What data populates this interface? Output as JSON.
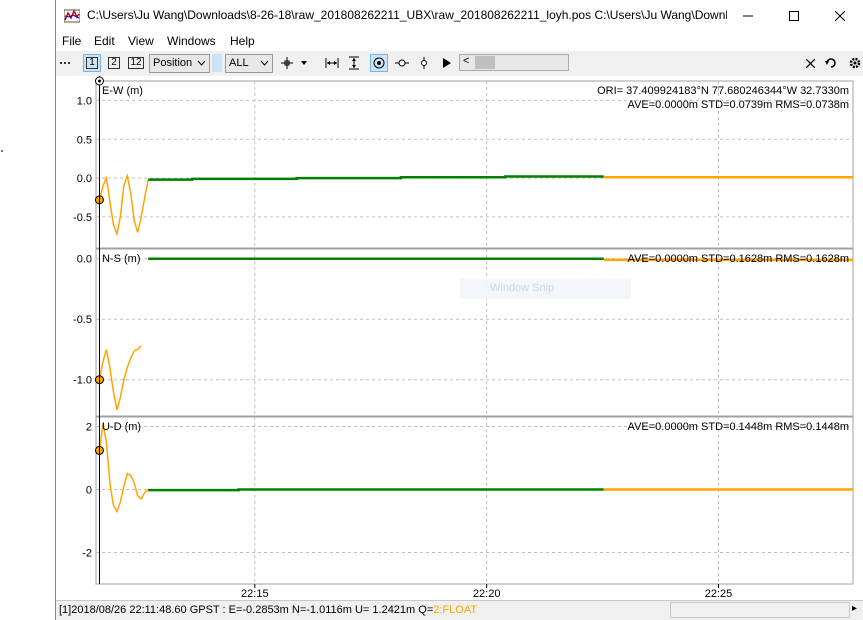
{
  "window": {
    "title": "C:\\Users\\Ju Wang\\Downloads\\8-26-18\\raw_201808262211_UBX\\raw_201808262211_loyh.pos C:\\Users\\Ju Wang\\Downlo...",
    "minimize_icon": "minimize-icon",
    "maximize_icon": "maximize-icon",
    "close_icon": "close-icon"
  },
  "menu": [
    "File",
    "Edit",
    "View",
    "Windows",
    "Help"
  ],
  "toolbar": {
    "btn1": "1",
    "btn2": "2",
    "btn12": "12",
    "plot_type": "Position",
    "quality": "ALL",
    "scroll_left": "<"
  },
  "colors": {
    "fix": "#008000",
    "float": "#ffa500",
    "grid": "#c0c0c0",
    "accent": "#cce4f7"
  },
  "chart_data": [
    {
      "type": "line",
      "title": "E-W (m)",
      "ori": "ORI= 37.409924183°N   77.680246344°W 32.7330m",
      "stats": "AVE=0.0000m STD=0.0739m RMS=0.0738m",
      "ylabel": "E-W (m)",
      "yticks": [
        "1.0",
        "0.5",
        "0.0",
        "-0.5"
      ],
      "ylim": [
        -0.9,
        1.25
      ],
      "series": [
        {
          "quality": "float",
          "x": [
            0.0,
            0.3,
            0.6,
            0.9,
            1.2,
            1.5,
            1.8,
            2.1,
            2.4,
            2.7,
            3.0,
            3.3,
            3.6,
            3.9,
            4.2
          ],
          "values": [
            -0.28,
            -0.1,
            0.0,
            -0.3,
            -0.6,
            -0.72,
            -0.5,
            -0.1,
            0.03,
            -0.2,
            -0.55,
            -0.7,
            -0.5,
            -0.25,
            -0.02
          ]
        },
        {
          "quality": "fix",
          "x": [
            4.2,
            8,
            8,
            17,
            17,
            26,
            26,
            35,
            35,
            43.5
          ],
          "values": [
            -0.02,
            -0.02,
            -0.01,
            -0.01,
            0.0,
            0.0,
            0.01,
            0.01,
            0.02,
            0.02
          ]
        },
        {
          "quality": "float",
          "x": [
            43.5,
            65
          ],
          "values": [
            0.01,
            0.01
          ]
        }
      ]
    },
    {
      "type": "line",
      "title": "N-S (m)",
      "stats": "AVE=0.0000m STD=0.1628m RMS=0.1628m",
      "ylabel": "N-S (m)",
      "yticks": [
        "0.0",
        "-0.5",
        "-1.0"
      ],
      "ylim": [
        -1.3,
        0.08
      ],
      "series": [
        {
          "quality": "float",
          "x": [
            0.0,
            0.3,
            0.6,
            0.9,
            1.2,
            1.5,
            1.8,
            2.1,
            2.4,
            2.7,
            3.0,
            3.3,
            3.6
          ],
          "values": [
            -1.0,
            -0.85,
            -0.75,
            -0.9,
            -1.1,
            -1.25,
            -1.15,
            -1.0,
            -0.9,
            -0.82,
            -0.76,
            -0.75,
            -0.72
          ]
        },
        {
          "quality": "fix",
          "x": [
            4.2,
            43.5
          ],
          "values": [
            0.0,
            0.0
          ]
        },
        {
          "quality": "float",
          "x": [
            43.5,
            65
          ],
          "values": [
            -0.01,
            -0.01
          ]
        }
      ]
    },
    {
      "type": "line",
      "title": "U-D (m)",
      "stats": "AVE=0.0000m STD=0.1448m RMS=0.1448m",
      "ylabel": "U-D (m)",
      "yticks": [
        "2",
        "0",
        "-2"
      ],
      "ylim": [
        -3.0,
        2.3
      ],
      "series": [
        {
          "quality": "float",
          "x": [
            0.0,
            0.3,
            0.6,
            0.9,
            1.2,
            1.5,
            1.8,
            2.1,
            2.4,
            2.7,
            3.0,
            3.3,
            3.6,
            3.9,
            4.2
          ],
          "values": [
            1.24,
            2.1,
            1.5,
            0.2,
            -0.5,
            -0.7,
            -0.4,
            0.1,
            0.5,
            0.45,
            0.2,
            -0.2,
            -0.3,
            -0.1,
            0.0
          ]
        },
        {
          "quality": "fix",
          "x": [
            4.2,
            12,
            12,
            43.5
          ],
          "values": [
            -0.02,
            -0.02,
            0.0,
            0.0
          ]
        },
        {
          "quality": "float",
          "x": [
            43.5,
            65
          ],
          "values": [
            0.0,
            0.0
          ]
        }
      ]
    }
  ],
  "time_axis": {
    "xlim": [
      -0.3,
      65
    ],
    "ticks": [
      {
        "label": "22:15",
        "x": 13.4
      },
      {
        "label": "22:20",
        "x": 33.4
      },
      {
        "label": "22:25",
        "x": 53.4
      }
    ]
  },
  "status": {
    "text": "[1]2018/08/26 22:11:48.60 GPST : E=-0.2853m N=-1.0116m U= 1.2421m Q=",
    "quality": "2:FLOAT"
  },
  "overlay": {
    "snip_label": "Window Snip"
  }
}
